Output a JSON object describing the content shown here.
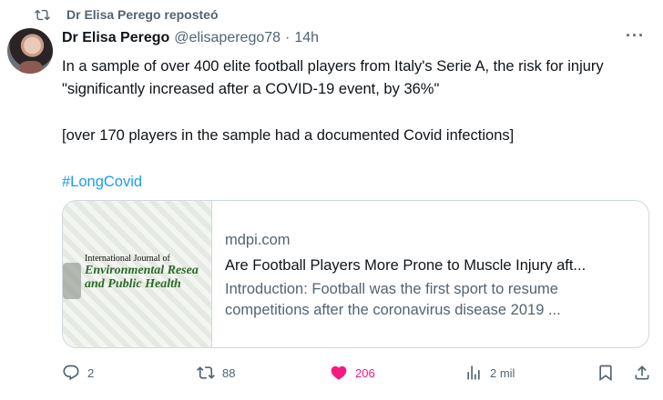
{
  "repost": {
    "label": "Dr Elisa Perego reposteó"
  },
  "tweet": {
    "author": "Dr Elisa Perego",
    "handle": "@elisaperego78",
    "separator": "·",
    "time": "14h",
    "more_label": "···",
    "paragraphs": [
      "In a sample of over 400 elite football players from Italy's Serie A, the risk for injury \"significantly increased after a COVID-19 event, by 36%\"",
      "[over 170 players in the sample had a documented Covid infections]"
    ],
    "hashtag": "#LongCovid"
  },
  "card": {
    "journal_top": "International Journal of",
    "journal_mid": "Environmental Resea",
    "journal_bot": "and Public Health",
    "domain": "mdpi.com",
    "title": "Are Football Players More Prone to Muscle Injury aft...",
    "description": "Introduction: Football was the first sport to resume competitions after the coronavirus disease 2019 ..."
  },
  "actions": {
    "replies": "2",
    "reposts": "88",
    "likes": "206",
    "views": "2 mil"
  },
  "colors": {
    "accent": "#1d9bf0",
    "like": "#f91880",
    "muted": "#536471"
  },
  "icons": [
    "repost-icon",
    "more-icon",
    "reply-icon",
    "repost-icon",
    "like-icon",
    "views-icon",
    "bookmark-icon",
    "share-icon"
  ]
}
